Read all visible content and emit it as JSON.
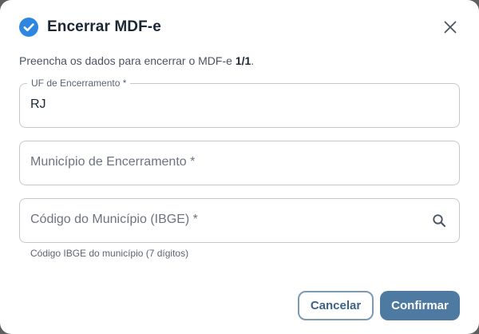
{
  "dialog": {
    "title": "Encerrar MDF-e",
    "close_label": "×",
    "description_prefix": "Preencha os dados para encerrar o MDF-e ",
    "description_count": "1/1",
    "description_suffix": "."
  },
  "form": {
    "uf": {
      "label": "UF de Encerramento *",
      "value": "RJ"
    },
    "municipio": {
      "placeholder": "Município de Encerramento *"
    },
    "codigo": {
      "placeholder": "Código do Município (IBGE) *",
      "helper": "Código IBGE do município (7 dígitos)"
    }
  },
  "actions": {
    "cancel_label": "Cancelar",
    "confirm_label": "Confirmar"
  },
  "colors": {
    "accent": "#4e7aa1",
    "check_icon": "#2f86e0"
  },
  "icons": [
    "check-circle-icon",
    "close-icon",
    "search-icon"
  ]
}
